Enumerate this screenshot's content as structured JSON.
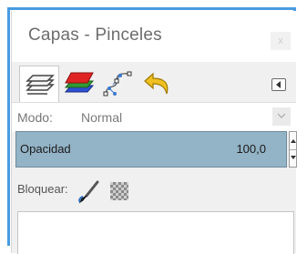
{
  "window": {
    "title": "Capas - Pinceles",
    "close_symbol": "x"
  },
  "tabs": [
    {
      "name": "layers",
      "icon": "layers-icon"
    },
    {
      "name": "channels",
      "icon": "channels-icon"
    },
    {
      "name": "paths",
      "icon": "paths-icon"
    },
    {
      "name": "undo-history",
      "icon": "undo-icon"
    }
  ],
  "mode": {
    "label": "Modo:",
    "value": "Normal"
  },
  "opacity": {
    "label": "Opacidad",
    "value": "100,0"
  },
  "lock": {
    "label": "Bloquear:"
  },
  "colors": {
    "accent_frame": "#4a9be0",
    "opacity_bar": "#93b3c6"
  }
}
